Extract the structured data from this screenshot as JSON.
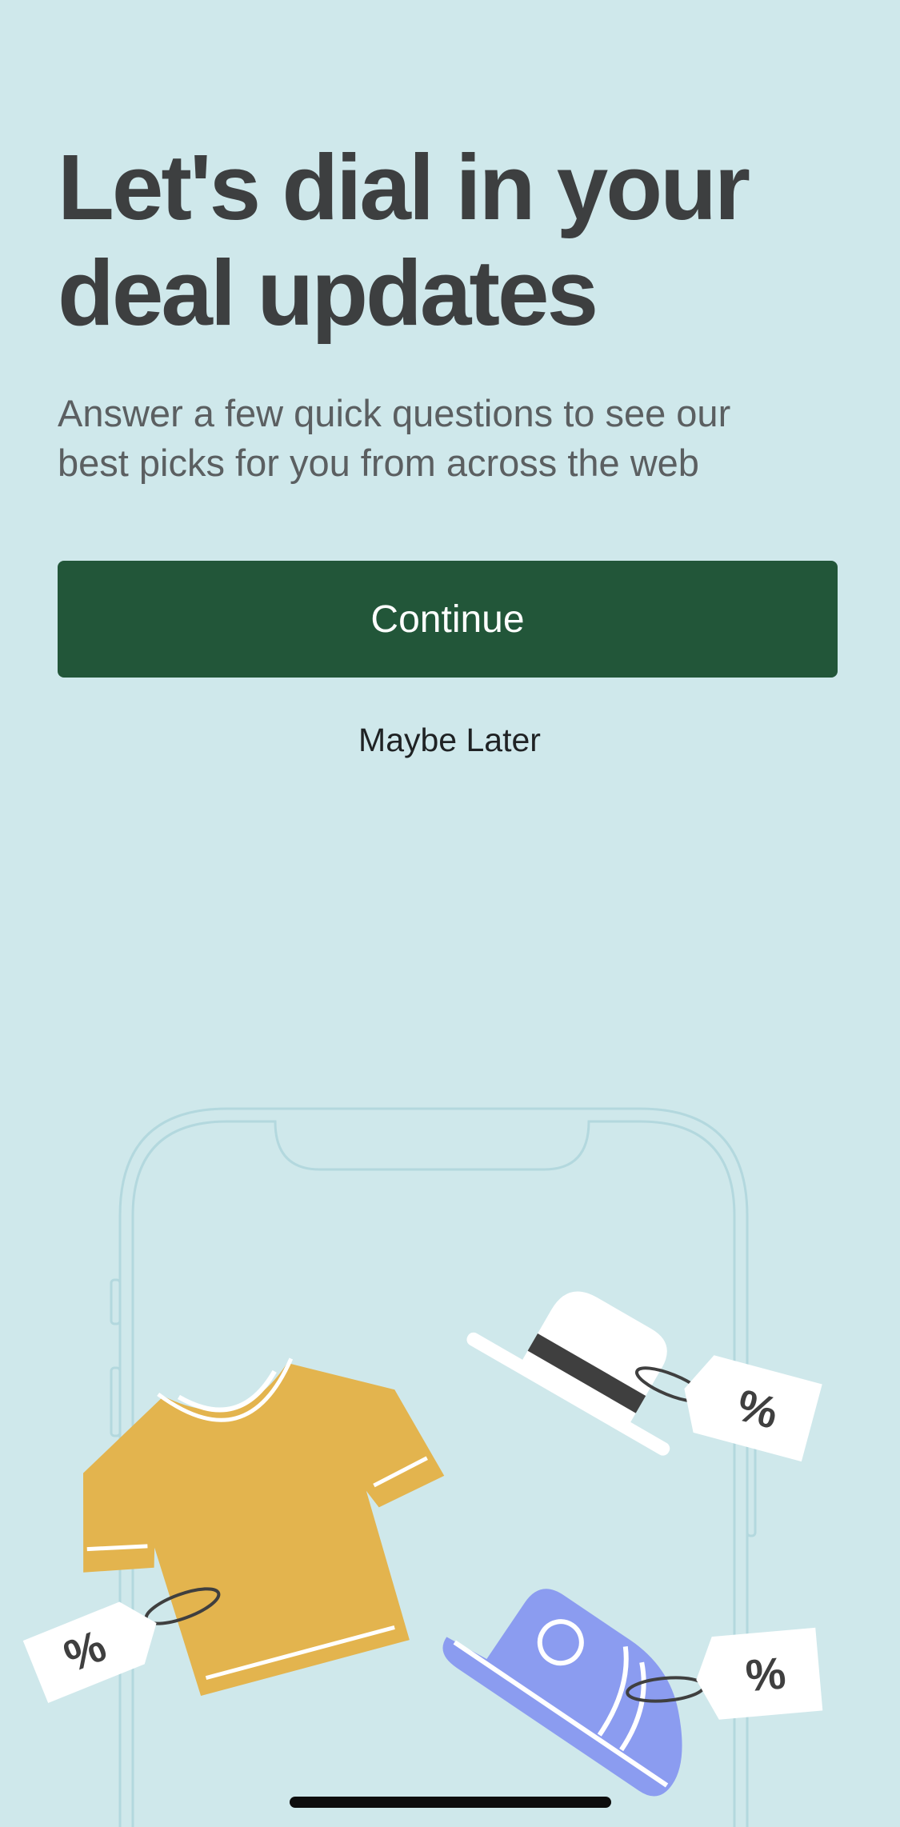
{
  "onboarding": {
    "headline_line1": "Let's dial in your",
    "headline_line2": "deal updates",
    "subhead_line1": "Answer a few quick questions to see our",
    "subhead_line2": "best picks for you from across the web",
    "continue_label": "Continue",
    "maybe_later_label": "Maybe Later"
  },
  "illustration": {
    "items": [
      "phone-outline",
      "t-shirt",
      "hat",
      "sneaker"
    ],
    "tag_symbol": "%"
  },
  "colors": {
    "background": "#cfe8eb",
    "primary_button": "#225639",
    "headline": "#3d3f40",
    "shirt": "#e3b44e",
    "sneaker": "#8b9cf0"
  }
}
